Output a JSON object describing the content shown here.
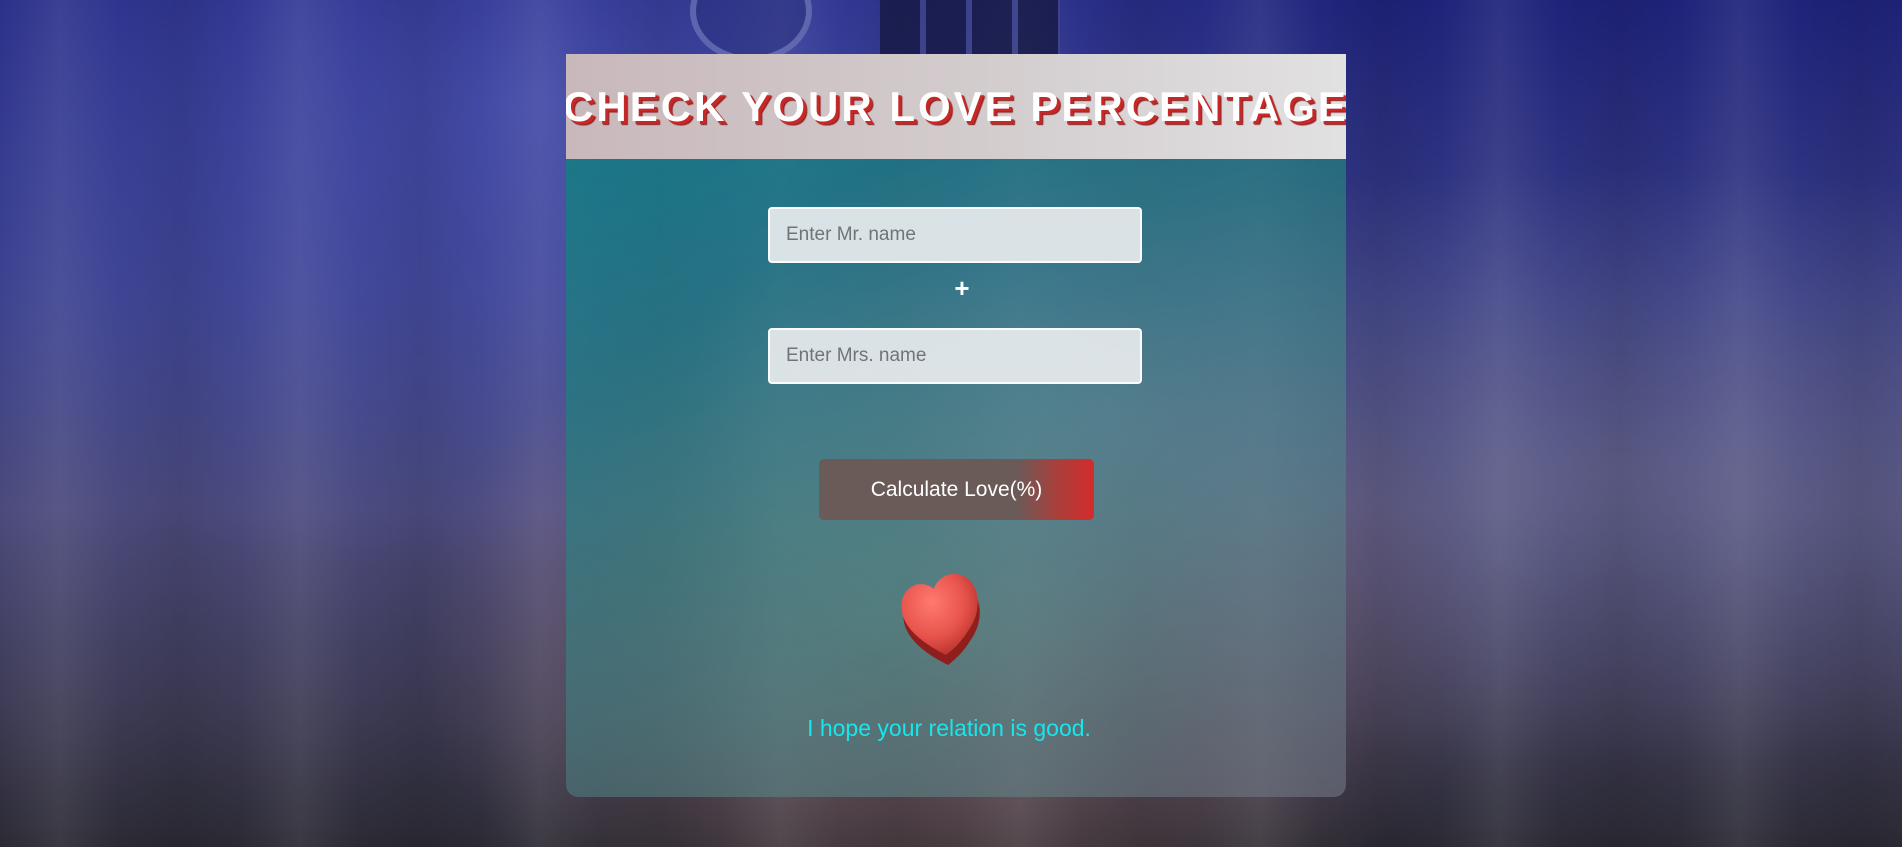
{
  "header": {
    "title": "CHECK YOUR LOVE PERCENTAGE"
  },
  "form": {
    "mr_placeholder": "Enter Mr. name",
    "mr_value": "",
    "plus_sign": "+",
    "mrs_placeholder": "Enter Mrs. name",
    "mrs_value": "",
    "button_label": "Calculate Love(%)"
  },
  "result": {
    "icon": "heart-icon",
    "message": "I hope your relation is good."
  },
  "colors": {
    "title_shadow": "#c62828",
    "message_text": "#17e6ea",
    "button_base": "#6a5a58",
    "button_accent": "#d32b2b",
    "heart": "#e8544c"
  }
}
